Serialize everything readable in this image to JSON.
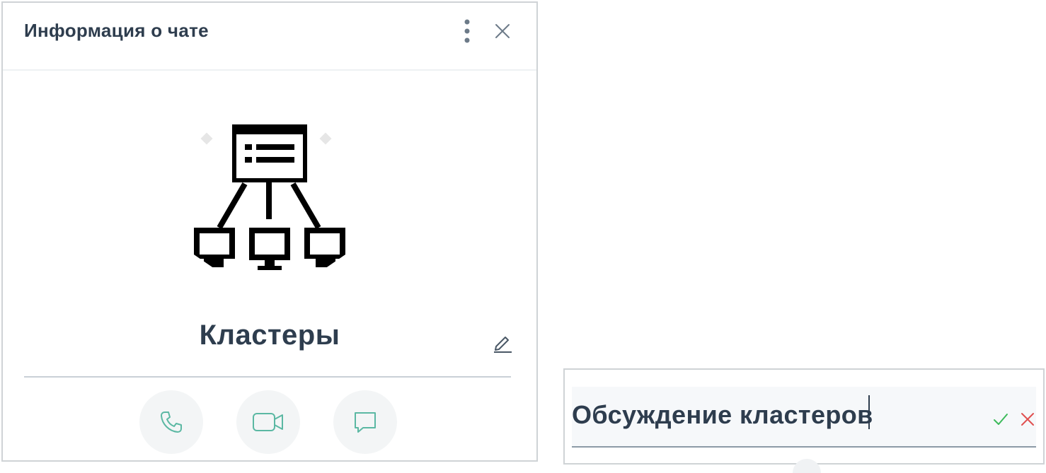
{
  "header": {
    "title": "Информация о чате",
    "more_icon": "more-vertical-icon",
    "close_icon": "close-icon"
  },
  "chat": {
    "name": "Кластеры",
    "avatar_icon": "network-cluster-icon",
    "edit_icon": "pencil-icon"
  },
  "actions": [
    {
      "icon": "phone-icon",
      "color": "#5bb8a3"
    },
    {
      "icon": "video-camera-icon",
      "color": "#5bb8a3"
    },
    {
      "icon": "chat-bubble-icon",
      "color": "#5bb8a3"
    }
  ],
  "edit": {
    "value": "Обсуждение кластеров",
    "confirm_icon": "checkmark-icon",
    "cancel_icon": "cross-icon",
    "confirm_color": "#3cba5a",
    "cancel_color": "#e05050"
  },
  "colors": {
    "text": "#2e3d4e",
    "accent": "#5bb8a3"
  }
}
